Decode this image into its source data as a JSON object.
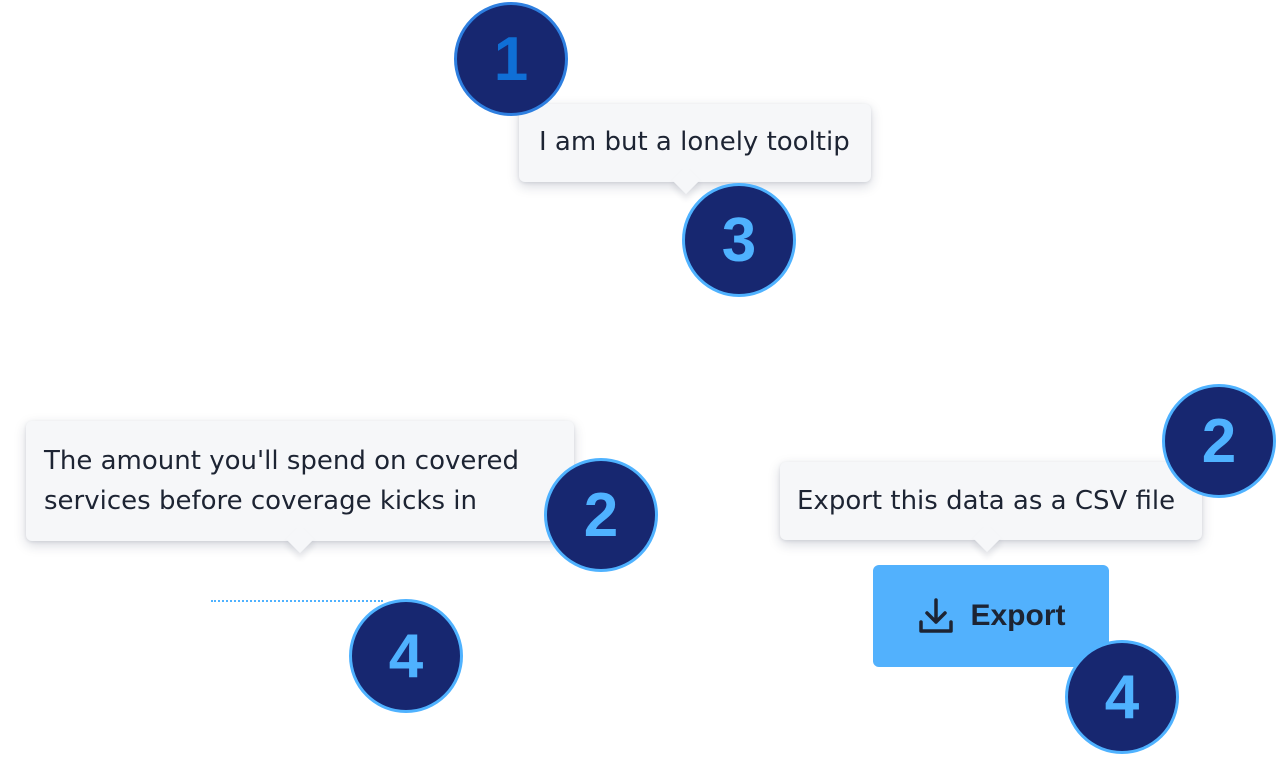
{
  "tooltips": {
    "lonely": "I am but a lonely tooltip",
    "covered": "The amount you'll spend on covered services before coverage kicks in",
    "export": "Export this data as a CSV file"
  },
  "badges": {
    "one": "1",
    "three": "3",
    "two_a": "2",
    "four_a": "4",
    "two_b": "2",
    "four_b": "4"
  },
  "export_button": {
    "label": "Export",
    "icon": "download-icon"
  },
  "colors": {
    "badge_fill": "#172770",
    "badge_text": "#4fb2ff",
    "button_bg": "#52b1fd",
    "tooltip_bg": "#f6f7f9",
    "text": "#1d2433"
  }
}
